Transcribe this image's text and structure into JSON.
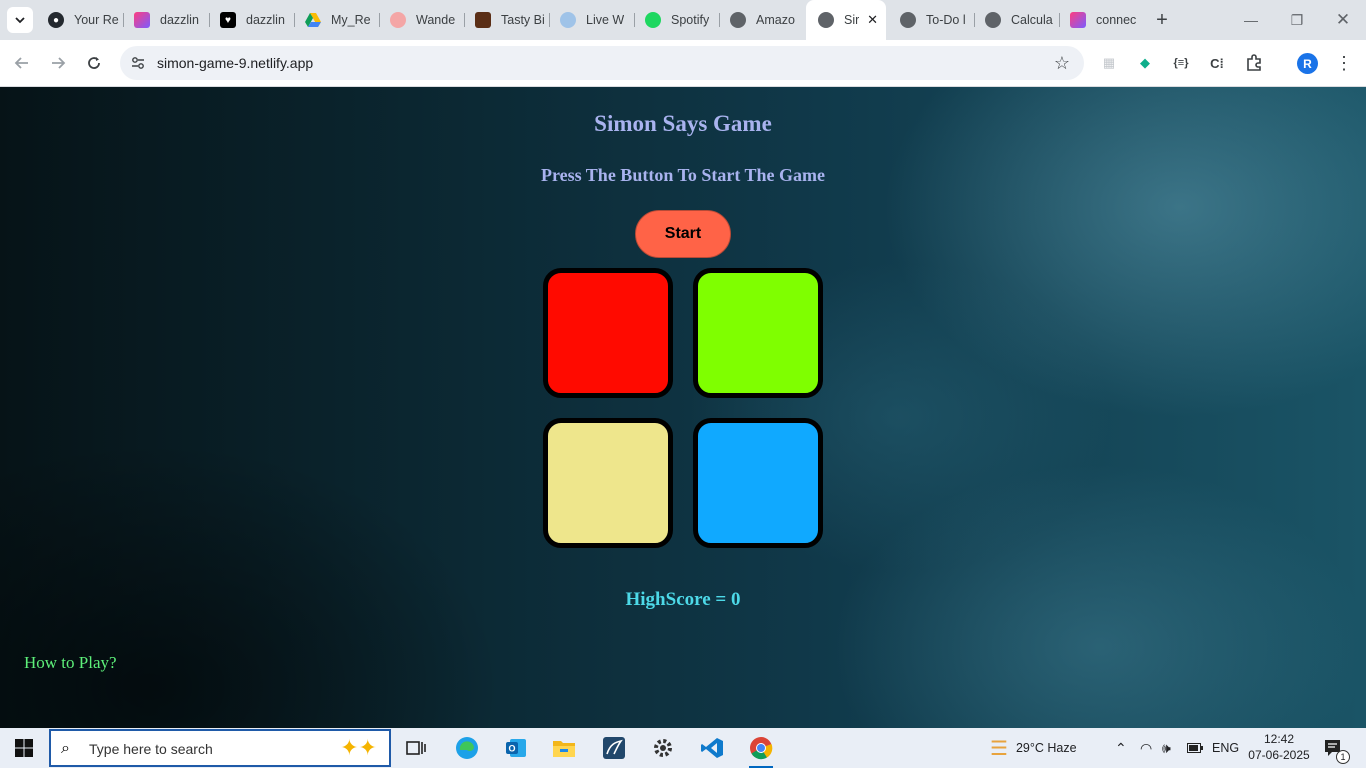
{
  "browser": {
    "tabs": [
      {
        "label": "Your Re",
        "icon": "github-icon"
      },
      {
        "label": "dazzlin",
        "icon": "heart-app-icon"
      },
      {
        "label": "dazzlin",
        "icon": "heart-outline-icon"
      },
      {
        "label": "My_Re",
        "icon": "google-drive-icon"
      },
      {
        "label": "Wande",
        "icon": "emoji-icon"
      },
      {
        "label": "Tasty Bi",
        "icon": "food-icon"
      },
      {
        "label": "Live W",
        "icon": "weather-icon"
      },
      {
        "label": "Spotify",
        "icon": "spotify-icon"
      },
      {
        "label": "Amazo",
        "icon": "globe-icon"
      },
      {
        "label": "Sir",
        "icon": "globe-icon",
        "active": true
      },
      {
        "label": "To-Do l",
        "icon": "globe-icon"
      },
      {
        "label": "Calcula",
        "icon": "globe-icon"
      },
      {
        "label": "connec",
        "icon": "heart-app-icon"
      }
    ],
    "url": "simon-game-9.netlify.app",
    "profile_initial": "R"
  },
  "game": {
    "title": "Simon Says Game",
    "subtitle": "Press The Button To Start The Game",
    "start_label": "Start",
    "buttons": [
      {
        "color": "#ff0a00",
        "name": "red"
      },
      {
        "color": "#7fff00",
        "name": "green"
      },
      {
        "color": "#eee68c",
        "name": "yellow"
      },
      {
        "color": "#10a9ff",
        "name": "blue"
      }
    ],
    "highscore_text": "HighScore = 0",
    "how_to_play": "How to Play?"
  },
  "taskbar": {
    "search_placeholder": "Type here to search",
    "weather": "29°C  Haze",
    "language": "ENG",
    "time": "12:42",
    "date": "07-06-2025",
    "notification_count": "1"
  },
  "colors": {
    "title": "#a9b3ef",
    "start_button": "#ff6347",
    "highscore": "#4dd9e8",
    "how_to_play": "#5df07a"
  }
}
